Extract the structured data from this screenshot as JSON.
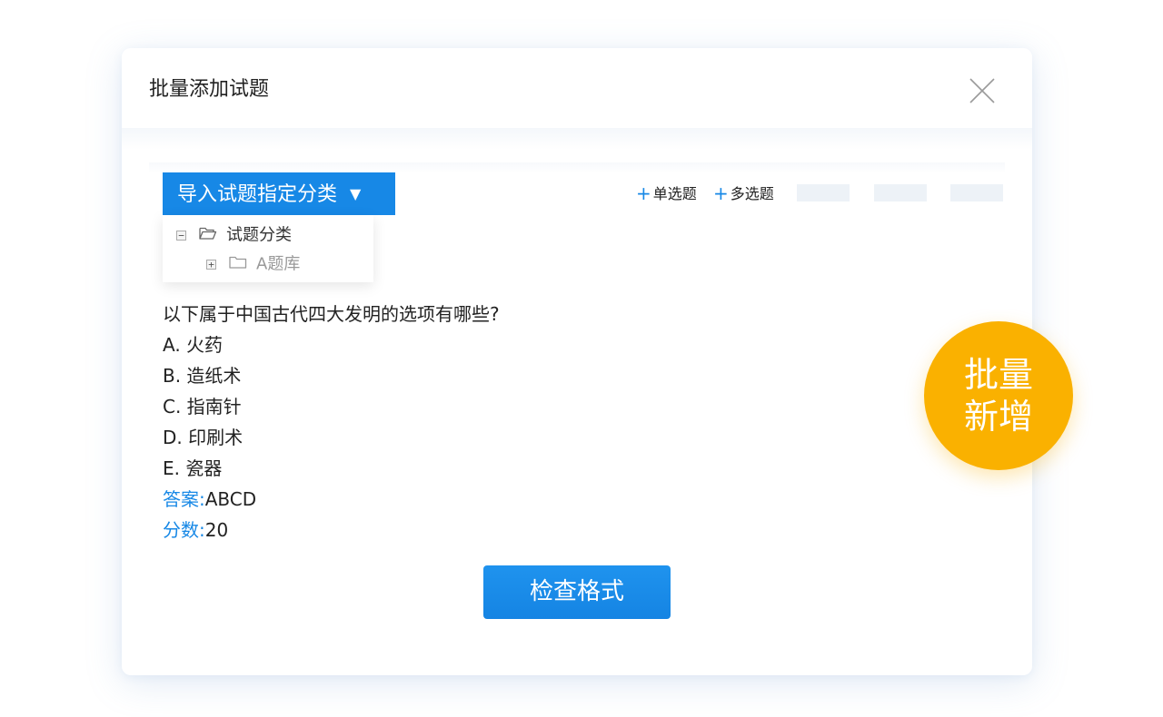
{
  "dialog": {
    "title": "批量添加试题",
    "close_icon": "close-icon"
  },
  "category_dropdown": {
    "label": "导入试题指定分类",
    "caret": "▼"
  },
  "tree": {
    "items": [
      {
        "toggle": "−",
        "label": "试题分类",
        "icon": "folder-open-icon"
      },
      {
        "toggle": "+",
        "label": "A题库",
        "icon": "folder-icon"
      }
    ]
  },
  "question_types": [
    {
      "plus": "+",
      "label": "单选题"
    },
    {
      "plus": "+",
      "label": "多选题"
    }
  ],
  "question": {
    "text": "以下属于中国古代四大发明的选项有哪些?",
    "options": [
      "A. 火药",
      "B. 造纸术",
      "C. 指南针",
      "D. 印刷术",
      "E. 瓷器"
    ],
    "answer_label": "答案:",
    "answer_value": "ABCD",
    "score_label": "分数:",
    "score_value": "20"
  },
  "check_button": {
    "label": "检查格式"
  },
  "badge": {
    "line1": "批量",
    "line2": "新增"
  },
  "colors": {
    "primary": "#1788e6",
    "badge": "#fab100",
    "placeholder": "#edf2f7"
  }
}
